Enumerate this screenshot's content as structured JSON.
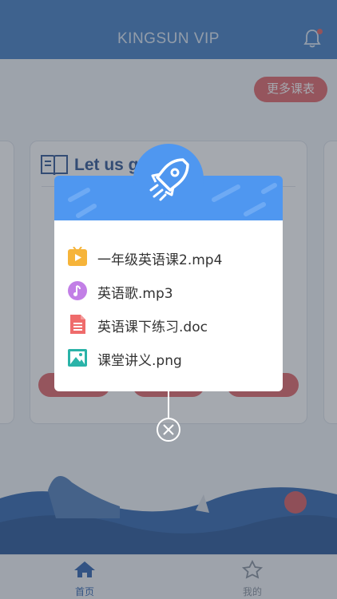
{
  "header": {
    "title": "KINGSUN VIP"
  },
  "main": {
    "more_button": "更多课表",
    "card_title": "Let us go"
  },
  "popup": {
    "files": [
      {
        "name": "一年级英语课2.mp4",
        "icon": "video-file-icon",
        "color": "#f6b43a"
      },
      {
        "name": "英语歌.mp3",
        "icon": "music-file-icon",
        "color": "#c27fe6"
      },
      {
        "name": "英语课下练习.doc",
        "icon": "document-file-icon",
        "color": "#ef6b6b"
      },
      {
        "name": "课堂讲义.png",
        "icon": "image-file-icon",
        "color": "#2ab3a8"
      }
    ]
  },
  "tabbar": {
    "home_label": "首页",
    "mine_label": "我的"
  },
  "colors": {
    "header_blue": "#4e86c6",
    "popup_blue": "#4f97f0",
    "accent_red": "#e36e72"
  }
}
